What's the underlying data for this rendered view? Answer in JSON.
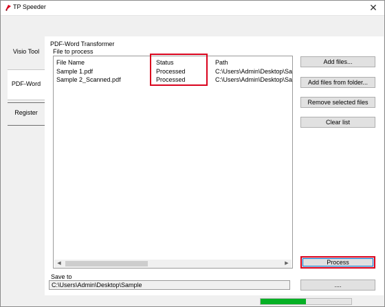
{
  "window": {
    "title": "TP Speeder",
    "close_glyph": "✕",
    "icon": "tp-logo-icon"
  },
  "sidebar": {
    "items": [
      {
        "label": "Visio Tool"
      },
      {
        "label": "PDF-Word",
        "selected": true
      },
      {
        "label": "Register"
      }
    ]
  },
  "panel": {
    "title": "PDF-Word Transformer",
    "files_label": "File to process",
    "columns": [
      "File Name",
      "Status",
      "Path"
    ],
    "rows": [
      {
        "name": "Sample 1.pdf",
        "status": "Processed",
        "path": "C:\\Users\\Admin\\Desktop\\Sa"
      },
      {
        "name": "Sample 2_Scanned.pdf",
        "status": "Processed",
        "path": "C:\\Users\\Admin\\Desktop\\Sa"
      }
    ]
  },
  "buttons": {
    "add_files": "Add files...",
    "add_folder": "Add files from folder...",
    "remove_selected": "Remove selected files",
    "clear_list": "Clear list",
    "process": "Process",
    "browse": "...."
  },
  "save_to": {
    "label": "Save to",
    "value": "C:\\Users\\Admin\\Desktop\\Sample"
  },
  "progress": {
    "value": 0.5
  },
  "colors": {
    "highlight": "#d9001b",
    "progress": "#06b025",
    "focus": "#0078d7"
  }
}
